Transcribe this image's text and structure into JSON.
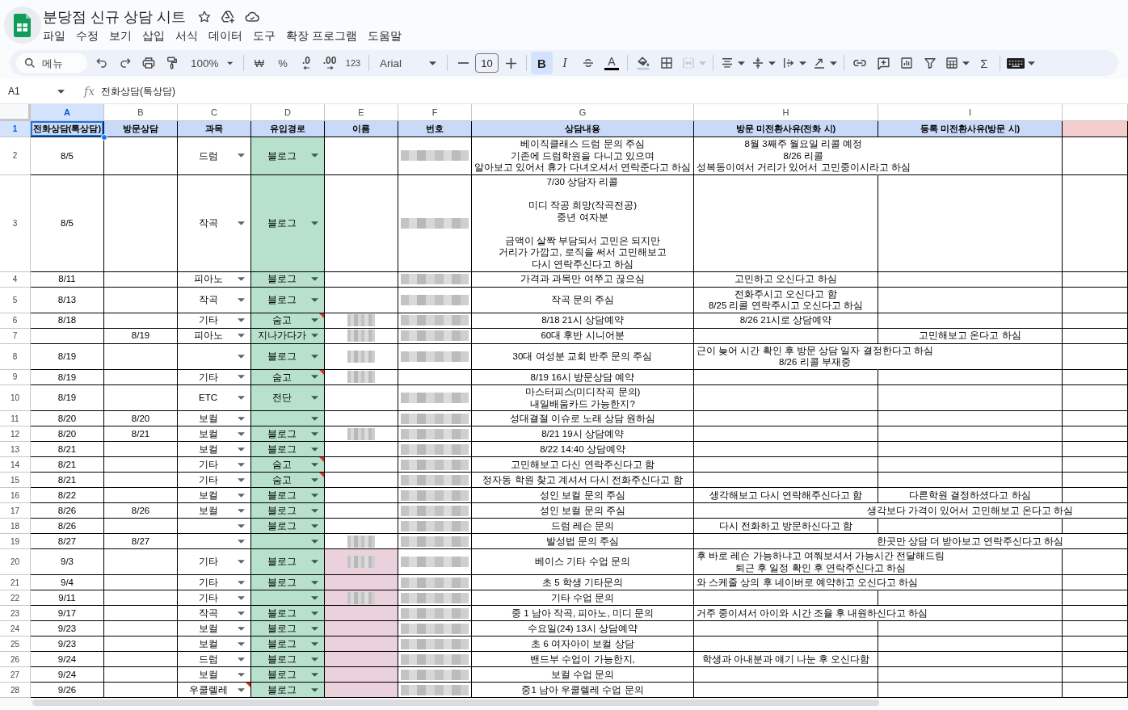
{
  "title_bar": {
    "title": "분당점 신규 상담 시트"
  },
  "menu": [
    "파일",
    "수정",
    "보기",
    "삽입",
    "서식",
    "데이터",
    "도구",
    "확장 프로그램",
    "도움말"
  ],
  "toolbar": {
    "search_placeholder": "메뉴",
    "zoom": "100%",
    "currency": "₩",
    "percent": "%",
    "decrease_decimal": ".0",
    "increase_decimal": ".00",
    "number_format": "123",
    "font": "Arial",
    "font_size": "10",
    "bold": "B",
    "bold_on": true,
    "italic": "I",
    "italic_on": false,
    "text_color": "A",
    "merge_disabled": true,
    "sum": "Σ"
  },
  "formula_bar": {
    "cell_ref": "A1",
    "fx": "fx",
    "value": "전화상담(톡상담)"
  },
  "columns": [
    {
      "letter": "A",
      "selected": true
    },
    {
      "letter": "B",
      "selected": false
    },
    {
      "letter": "C",
      "selected": false
    },
    {
      "letter": "D",
      "selected": false,
      "color": "#b7e1cd"
    },
    {
      "letter": "E",
      "selected": false
    },
    {
      "letter": "F",
      "selected": false
    },
    {
      "letter": "G",
      "selected": false
    },
    {
      "letter": "H",
      "selected": false
    },
    {
      "letter": "I",
      "selected": false
    }
  ],
  "header_row": {
    "row": "1",
    "selected": true,
    "cells": [
      "전화상담(톡상담)",
      "방문상담",
      "과목",
      "유입경로",
      "이름",
      "번호",
      "상담내용",
      "방문 미전환사유(전화 시)",
      "등록 미전환사유(방문 시)"
    ]
  },
  "rows": [
    {
      "row": "2",
      "selected": false,
      "call_date": "8/5",
      "subject": "드럼",
      "subject_note": false,
      "source": "블로그",
      "source_note": false,
      "name_blurred": false,
      "name_highlight": false,
      "contact_blurred": true,
      "details": "베이직클래스 드럼 문의 주심\n기존에 드럼학원을 다니고 있으며\n알아보고 있어서 휴가 다녀오셔서 연락준다고 하심",
      "visit_reason": "8월 3째주 월요일 리콜 예정\n8/26 리콜\n성복동이여서 거리가 있어서 고민중이시라고 하심"
    },
    {
      "row": "3",
      "selected": false,
      "call_date": "8/5",
      "subject": "작곡",
      "subject_note": false,
      "source": "블로그",
      "source_note": false,
      "name_blurred": false,
      "name_highlight": false,
      "contact_blurred": true,
      "details": "7/30 상담자 리콜\n\n미디 작공 희망(작곡전공)\n중년 여자분\n\n금액이 살짝 부담되서 고민은 되지만\n거리가 가깝고, 로직을 써서 고민해보고\n다시 연락주신다고 하심"
    },
    {
      "row": "4",
      "selected": false,
      "call_date": "8/11",
      "subject": "피아노",
      "subject_note": false,
      "source": "블로그",
      "source_note": false,
      "name_blurred": false,
      "name_highlight": false,
      "contact_blurred": true,
      "details": "가격과 과목만 여쭈고 끊으심",
      "visit_reason": "고민하고 오신다고 하심"
    },
    {
      "row": "5",
      "selected": false,
      "call_date": "8/13",
      "subject": "작곡",
      "subject_note": false,
      "source": "블로그",
      "source_note": false,
      "name_blurred": false,
      "name_highlight": false,
      "contact_blurred": true,
      "details": "작곡 문의 주심",
      "visit_reason": "전화주시고 오신다고 함\n8/25 리콜 연락주시고 오신다고 하심"
    },
    {
      "row": "6",
      "selected": false,
      "call_date": "8/18",
      "subject": "기타",
      "subject_note": false,
      "source": "숨고",
      "source_note": true,
      "name_blurred": true,
      "name_highlight": false,
      "contact_blurred": true,
      "details": "8/18 21시 상담예약",
      "visit_reason": "8/26 21시로 상담예약"
    },
    {
      "row": "7",
      "selected": false,
      "visit_date": "8/19",
      "subject": "피아노",
      "subject_note": false,
      "source": "지나가다가",
      "source_note": false,
      "name_blurred": true,
      "name_highlight": false,
      "contact_blurred": true,
      "details": "60대 후반 시니어분",
      "signup_reason": "고민해보고 온다고 하심"
    },
    {
      "row": "8",
      "selected": false,
      "call_date": "8/19",
      "subject_note": false,
      "source": "블로그",
      "source_note": false,
      "name_blurred": true,
      "name_highlight": false,
      "contact_blurred": true,
      "details": "30대 여성분 교회 반주 문의 주심",
      "visit_reason": "근이 늦어 시간 확인 후 방문 상담 일자 결정한다고 하심\n8/26 리콜 부재중"
    },
    {
      "row": "9",
      "selected": false,
      "call_date": "8/19",
      "subject": "기타",
      "subject_note": false,
      "source": "숨고",
      "source_note": true,
      "name_blurred": true,
      "name_highlight": false,
      "contact_blurred": false,
      "details": "8/19 16시 방문상담 예약"
    },
    {
      "row": "10",
      "selected": false,
      "call_date": "8/19",
      "subject": "ETC",
      "subject_note": false,
      "source": "전단",
      "source_note": false,
      "name_blurred": false,
      "name_highlight": false,
      "contact_blurred": true,
      "details": "마스터피스(미디작곡 문의)\n내일배움카드 가능한지?"
    },
    {
      "row": "11",
      "selected": false,
      "call_date": "8/20",
      "visit_date": "8/20",
      "subject": "보컬",
      "subject_note": false,
      "source_note": false,
      "name_blurred": false,
      "name_highlight": false,
      "contact_blurred": true,
      "details": "성대결절 이슈로 노래 상담 원하심"
    },
    {
      "row": "12",
      "selected": false,
      "call_date": "8/20",
      "visit_date": "8/21",
      "subject": "보컬",
      "subject_note": false,
      "source": "블로그",
      "source_note": false,
      "name_blurred": true,
      "name_highlight": false,
      "contact_blurred": true,
      "details": "8/21 19시 상담예약"
    },
    {
      "row": "13",
      "selected": false,
      "call_date": "8/21",
      "subject": "보컬",
      "subject_note": false,
      "source": "블로그",
      "source_note": false,
      "name_blurred": false,
      "name_highlight": false,
      "contact_blurred": true,
      "details": "8/22 14:40 상담예약"
    },
    {
      "row": "14",
      "selected": false,
      "call_date": "8/21",
      "subject": "기타",
      "subject_note": false,
      "source": "숨고",
      "source_note": true,
      "name_blurred": false,
      "name_highlight": false,
      "contact_blurred": true,
      "details": "고민해보고 다신 연락주신다고 함"
    },
    {
      "row": "15",
      "selected": false,
      "call_date": "8/21",
      "subject": "기타",
      "subject_note": false,
      "source": "숨고",
      "source_note": true,
      "name_blurred": false,
      "name_highlight": false,
      "contact_blurred": true,
      "details": "정자동 학원 찾고 계셔서 다시 전화주신다고 함"
    },
    {
      "row": "16",
      "selected": false,
      "call_date": "8/22",
      "subject": "보컬",
      "subject_note": false,
      "source": "블로그",
      "source_note": false,
      "name_blurred": false,
      "name_highlight": false,
      "contact_blurred": true,
      "details": "성인 보컬 문의 주심",
      "visit_reason": "생각해보고 다시 연락해주신다고 함",
      "signup_reason": "다른학원 결정하셨다고 하심"
    },
    {
      "row": "17",
      "selected": false,
      "call_date": "8/26",
      "visit_date": "8/26",
      "subject": "보컬",
      "subject_note": false,
      "source": "블로그",
      "source_note": false,
      "name_blurred": false,
      "name_highlight": false,
      "contact_blurred": true,
      "details": "성인 보컬 문의 주심",
      "signup_reason": "생각보다 가격이 있어서 고민해보고 온다고 하심"
    },
    {
      "row": "18",
      "selected": false,
      "call_date": "8/26",
      "subject_note": false,
      "source": "블로그",
      "source_note": false,
      "name_blurred": false,
      "name_highlight": false,
      "contact_blurred": true,
      "details": "드럼 레슨 문의",
      "visit_reason": "다시 전화하고 방문하신다고 함"
    },
    {
      "row": "19",
      "selected": false,
      "call_date": "8/27",
      "visit_date": "8/27",
      "subject_note": false,
      "source_note": false,
      "name_blurred": true,
      "name_highlight": false,
      "contact_blurred": true,
      "details": "발성법 문의 주심",
      "signup_reason": "한곳만 상담 더 받아보고 연락주신다고 하심"
    },
    {
      "row": "20",
      "selected": false,
      "call_date": "9/3",
      "subject": "기타",
      "subject_note": false,
      "source": "블로그",
      "source_note": false,
      "name_blurred": true,
      "name_highlight": true,
      "contact_blurred": true,
      "details": "베이스 기타 수업 문의",
      "visit_reason": "후 바로 레슨 가능하냐고 여쭤보셔서 가능시간 전달해드림\n퇴근 후 일정 확인 후 연락주신다고 하심"
    },
    {
      "row": "21",
      "selected": false,
      "call_date": "9/4",
      "subject": "기타",
      "subject_note": false,
      "source": "블로그",
      "source_note": false,
      "name_blurred": false,
      "name_highlight": true,
      "contact_blurred": true,
      "details": "초 5 학생 기타문의",
      "visit_reason": "와 스케줄 상의 후 네이버로 예약하고 오신다고 하심"
    },
    {
      "row": "22",
      "selected": false,
      "call_date": "9/11",
      "subject": "기타",
      "subject_note": false,
      "source_note": false,
      "name_blurred": true,
      "name_highlight": true,
      "contact_blurred": true,
      "details": "기타 수업 문의"
    },
    {
      "row": "23",
      "selected": false,
      "call_date": "9/17",
      "subject": "작곡",
      "subject_note": false,
      "source": "블로그",
      "source_note": false,
      "name_blurred": false,
      "name_highlight": true,
      "contact_blurred": true,
      "details": "중 1 남아 작곡, 피아노, 미디 문의",
      "visit_reason": "거주 중이셔서 아이와 시간 조율 후 내원하신다고 하심"
    },
    {
      "row": "24",
      "selected": false,
      "call_date": "9/23",
      "subject": "보컬",
      "subject_note": false,
      "source": "블로그",
      "source_note": false,
      "name_blurred": false,
      "name_highlight": true,
      "contact_blurred": true,
      "details": "수요일(24) 13시 상담예약"
    },
    {
      "row": "25",
      "selected": false,
      "call_date": "9/23",
      "subject": "보컬",
      "subject_note": false,
      "source": "블로그",
      "source_note": false,
      "name_blurred": false,
      "name_highlight": true,
      "contact_blurred": true,
      "details": "초 6 여자아이 보컬 상담"
    },
    {
      "row": "26",
      "selected": false,
      "call_date": "9/24",
      "subject": "드럼",
      "subject_note": false,
      "source": "블로그",
      "source_note": false,
      "name_blurred": false,
      "name_highlight": true,
      "contact_blurred": true,
      "details": "밴드부 수업이 가능한지,",
      "visit_reason": "학생과 아내분과 얘기 나눈 후 오신다함"
    },
    {
      "row": "27",
      "selected": false,
      "call_date": "9/24",
      "subject": "보컬",
      "subject_note": false,
      "source": "블로그",
      "source_note": false,
      "name_blurred": false,
      "name_highlight": true,
      "contact_blurred": true,
      "details": "보컬 수업 문의"
    },
    {
      "row": "28",
      "selected": false,
      "call_date": "9/26",
      "subject": "우쿨렐레",
      "subject_note": true,
      "source": "블로그",
      "source_note": false,
      "name_blurred": false,
      "name_highlight": true,
      "contact_blurred": true,
      "details": "중1 남아 우쿨렐레 수업 문의"
    }
  ]
}
